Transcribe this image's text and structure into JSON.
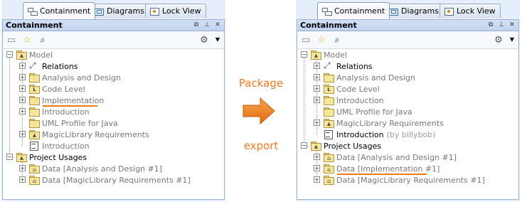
{
  "left": {
    "tabs": [
      {
        "label": "Containment",
        "icon": "containment-tree-icon",
        "active": true
      },
      {
        "label": "Diagrams",
        "icon": "diagrams-icon",
        "active": false
      },
      {
        "label": "Lock View",
        "icon": "lock-view-icon",
        "active": false
      }
    ],
    "title": "Containment",
    "tree": [
      {
        "label": "Model",
        "style": "gray",
        "icon": "model-icon"
      },
      {
        "label": "Relations",
        "style": "black",
        "icon": "relations-icon"
      },
      {
        "label": "Analysis and Design",
        "style": "gray",
        "icon": "package-icon"
      },
      {
        "label": "Code Level",
        "style": "gray",
        "icon": "code-package-icon"
      },
      {
        "label": "Implementation",
        "style": "gray",
        "icon": "package-icon",
        "highlight": true
      },
      {
        "label": "Introduction",
        "style": "gray",
        "icon": "package-icon"
      },
      {
        "label": "UML Profile for Java",
        "style": "gray",
        "icon": "package-icon"
      },
      {
        "label": "MagicLibrary Requirements",
        "style": "gray",
        "icon": "model-package-icon"
      },
      {
        "label": "Introduction",
        "style": "gray",
        "icon": "document-icon"
      },
      {
        "label": "Project Usages",
        "style": "black",
        "icon": "project-usages-icon"
      },
      {
        "label": "Data [Analysis and Design #1]",
        "style": "gray",
        "icon": "shared-package-icon"
      },
      {
        "label": "Data [MagicLibrary Requirements #1]",
        "style": "gray",
        "icon": "shared-package-icon"
      }
    ]
  },
  "middle": {
    "top_text": "Package",
    "bottom_text": "export",
    "accent_color": "#f07a1a"
  },
  "right": {
    "tabs": [
      {
        "label": "Containment",
        "icon": "containment-tree-icon",
        "active": true
      },
      {
        "label": "Diagrams",
        "icon": "diagrams-icon",
        "active": false
      },
      {
        "label": "Lock View",
        "icon": "lock-view-icon",
        "active": false
      }
    ],
    "title": "Containment",
    "tree": [
      {
        "label": "Model",
        "style": "gray",
        "icon": "model-icon"
      },
      {
        "label": "Relations",
        "style": "black",
        "icon": "relations-icon"
      },
      {
        "label": "Analysis and Design",
        "style": "gray",
        "icon": "package-icon"
      },
      {
        "label": "Code Level",
        "style": "gray",
        "icon": "code-package-icon"
      },
      {
        "label": "Introduction",
        "style": "gray",
        "icon": "package-icon"
      },
      {
        "label": "UML Profile for Java",
        "style": "gray",
        "icon": "package-icon"
      },
      {
        "label": "MagicLibrary Requirements",
        "style": "gray",
        "icon": "model-package-icon"
      },
      {
        "label": "Introduction",
        "style": "black",
        "icon": "document-icon",
        "suffix": "(by billybob)"
      },
      {
        "label": "Project Usages",
        "style": "black",
        "icon": "project-usages-icon"
      },
      {
        "label": "Data [Analysis and Design #1]",
        "style": "gray",
        "icon": "shared-package-icon"
      },
      {
        "label": "Data [Implementation #1]",
        "style": "gray",
        "icon": "shared-package-icon",
        "highlight": true
      },
      {
        "label": "Data [MagicLibrary Requirements #1]",
        "style": "gray",
        "icon": "shared-package-icon"
      }
    ]
  }
}
